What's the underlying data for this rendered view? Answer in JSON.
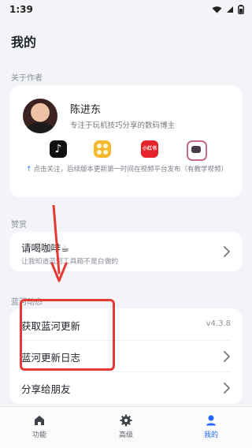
{
  "status_bar": {
    "time": "1:39"
  },
  "page": {
    "title": "我的"
  },
  "about": {
    "section": "关于作者",
    "author": {
      "name": "陈进东",
      "desc": "专注于玩机技巧分享的数码博主"
    },
    "social_icons": [
      "tiktok-icon",
      "coins-icon",
      "redbook-icon",
      "bilibili-icon"
    ],
    "note": "点击关注，后续版本更新第一时间在视频平台发布（有教学视频）"
  },
  "support": {
    "section": "赞赏",
    "title": "请喝咖啡☕",
    "subtitle": "让我知道蓝河工具箱不是白做的"
  },
  "lanhe": {
    "section": "蓝河动态",
    "items": [
      {
        "label": "获取蓝河更新",
        "value": "v4.3.8"
      },
      {
        "label": "蓝河更新日志"
      },
      {
        "label": "分享给朋友"
      }
    ]
  },
  "nav": {
    "items": [
      {
        "label": "功能"
      },
      {
        "label": "高级"
      },
      {
        "label": "我的"
      }
    ]
  },
  "colors": {
    "accent": "#1f68ff",
    "annotation": "#e53935",
    "background": "#f2f4f7"
  }
}
